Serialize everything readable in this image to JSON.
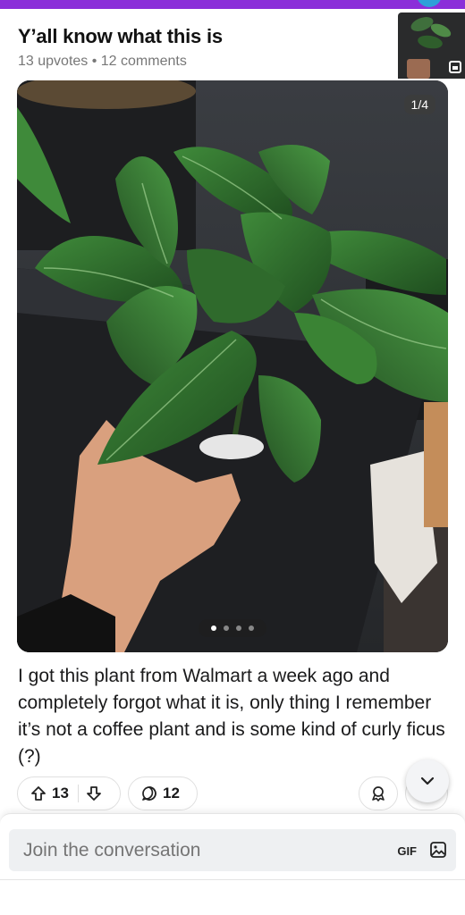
{
  "post": {
    "title": "Y’all know what this is",
    "meta": "13 upvotes • 12 comments",
    "body": "I got this plant from Walmart a week ago and completely forgot what it is, only thing I remember it’s not a coffee plant and is some kind of curly ficus (?)"
  },
  "gallery": {
    "counter": "1/4",
    "current": 1,
    "total": 4
  },
  "actions": {
    "upvotes": "13",
    "comments": "12"
  },
  "composer": {
    "placeholder": "Join the conversation",
    "gif_label": "GIF"
  },
  "icons": [
    "upvote-icon",
    "downvote-icon",
    "comment-icon",
    "award-icon",
    "chevron-down-icon",
    "image-icon",
    "gallery-icon"
  ],
  "colors": {
    "brand": "#8b2fd9",
    "text": "#1a1a1b",
    "muted": "#777777"
  }
}
